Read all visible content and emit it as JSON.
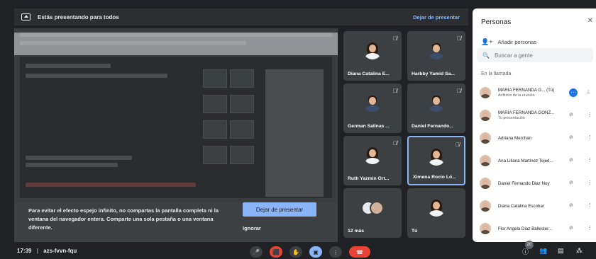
{
  "banner": {
    "title": "Estás presentando para todos",
    "stop_label": "Dejar de presentar"
  },
  "warning": {
    "message": "Para evitar el efecto espejo infinito, no compartas la pantalla completa ni la ventana del navegador entera. Comparte una sola pestaña o una ventana diferente.",
    "stop_button": "Dejar de presentar",
    "ignore_button": "Ignorar"
  },
  "tiles": [
    {
      "name": "Diana Catalina E...",
      "kind": "female",
      "muted": true
    },
    {
      "name": "Harbby Yamid Sa...",
      "kind": "male",
      "muted": true
    },
    {
      "name": "German Salinas ...",
      "kind": "male",
      "muted": true
    },
    {
      "name": "Daniel Fernando...",
      "kind": "male",
      "muted": true
    },
    {
      "name": "Ruth Yazmin Ort...",
      "kind": "female",
      "muted": true
    },
    {
      "name": "Ximena Rocio Ló...",
      "kind": "female",
      "muted": true,
      "active": true
    },
    {
      "name": "12 más",
      "kind": "group",
      "muted": false
    },
    {
      "name": "Tú",
      "kind": "female",
      "muted": false
    }
  ],
  "panel": {
    "title": "Personas",
    "add_label": "Añadir personas",
    "search_placeholder": "Buscar a gente",
    "section_label": "En la llamada",
    "people": [
      {
        "name": "MARIA FERNANDA G...",
        "suffix": "(Tú)",
        "subtitle": "Anfitrión de la reunión",
        "muted": false
      },
      {
        "name": "MARIA FERNANDA GONZ...",
        "subtitle": "Tu presentación",
        "muted": true
      },
      {
        "name": "Adriana Merchan",
        "subtitle": "",
        "muted": true
      },
      {
        "name": "Ana Liliana Martinez Tejed...",
        "subtitle": "",
        "muted": true
      },
      {
        "name": "Daniel Fernando Diaz Noy",
        "subtitle": "",
        "muted": true
      },
      {
        "name": "Diana Catalina Escobar",
        "subtitle": "",
        "muted": true
      },
      {
        "name": "Flor Angela Diaz Ballester...",
        "subtitle": "",
        "muted": true
      }
    ]
  },
  "bottom": {
    "time": "17:39",
    "meeting_code": "azs-fvvn-fqu",
    "participant_count": "20"
  },
  "icons": {
    "mic": "microphone-icon",
    "camera_off": "camera-off-icon",
    "hand": "raise-hand-icon",
    "present": "present-icon",
    "more": "more-vert-icon",
    "end": "end-call-icon",
    "info": "info-icon",
    "people": "people-icon",
    "chat": "chat-icon",
    "activities": "activities-icon"
  },
  "colors": {
    "accent": "#8ab4f8",
    "end_call": "#ea4335",
    "background": "#202124",
    "tile": "#3c4043"
  }
}
